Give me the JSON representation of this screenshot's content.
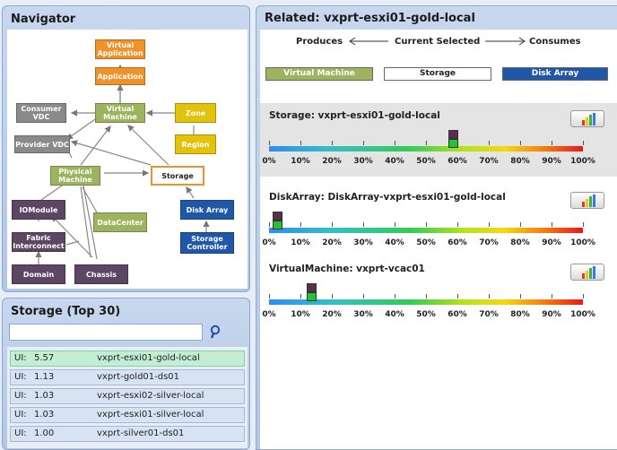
{
  "navigator": {
    "title": "Navigator",
    "nodes": {
      "virtual_application": "Virtual Application",
      "application": "Application",
      "virtual_machine": "Virtual Machine",
      "consumer_vdc": "Consumer VDC",
      "provider_vdc": "Provider VDC",
      "zone": "Zone",
      "region": "Region",
      "physical_machine": "Physical Machine",
      "storage": "Storage",
      "iomodule": "IOModule",
      "datacenter": "DataCenter",
      "disk_array": "Disk Array",
      "fabric_interconnect": "Fabric Interconnect",
      "storage_controller": "Storage Controller",
      "domain": "Domain",
      "chassis": "Chassis"
    }
  },
  "storage_list": {
    "title": "Storage (Top 30)",
    "search_placeholder": "",
    "rows": [
      {
        "ui_label": "UI:",
        "value": "5.57",
        "name": "vxprt-esxi01-gold-local",
        "selected": true
      },
      {
        "ui_label": "UI:",
        "value": "1.13",
        "name": "vxprt-gold01-ds01",
        "selected": false
      },
      {
        "ui_label": "UI:",
        "value": "1.03",
        "name": "vxprt-esxi02-silver-local",
        "selected": false
      },
      {
        "ui_label": "UI:",
        "value": "1.03",
        "name": "vxprt-esxi01-silver-local",
        "selected": false
      },
      {
        "ui_label": "UI:",
        "value": "1.00",
        "name": "vxprt-silver01-ds01",
        "selected": false
      }
    ]
  },
  "related": {
    "title": "Related: vxprt-esxi01-gold-local",
    "produces": "Produces",
    "current_selected": "Current Selected",
    "consumes": "Consumes",
    "legend": {
      "produces_item": "Virtual Machine",
      "current_item": "Storage",
      "consumes_item": "Disk Array"
    },
    "ticks": [
      "0%",
      "10%",
      "20%",
      "30%",
      "40%",
      "50%",
      "60%",
      "70%",
      "80%",
      "90%",
      "100%"
    ],
    "metrics": [
      {
        "title": "Storage: vxprt-esxi01-gold-local",
        "value_fraction": 0.585
      },
      {
        "title": "DiskArray: DiskArray-vxprt-esxi01-gold-local",
        "value_fraction": 0.025
      },
      {
        "title": "VirtualMachine: vxprt-vcac01",
        "value_fraction": 0.135
      }
    ]
  },
  "colors": {
    "produces": "#9db35e",
    "current": "#ffffff",
    "consumes": "#2057a8",
    "search_icon": "#1e4fb5"
  },
  "icons": {
    "search": "search-icon",
    "chart": "bar-chart-icon",
    "arrow_left": "arrow-left-icon",
    "arrow_right": "arrow-right-icon"
  }
}
